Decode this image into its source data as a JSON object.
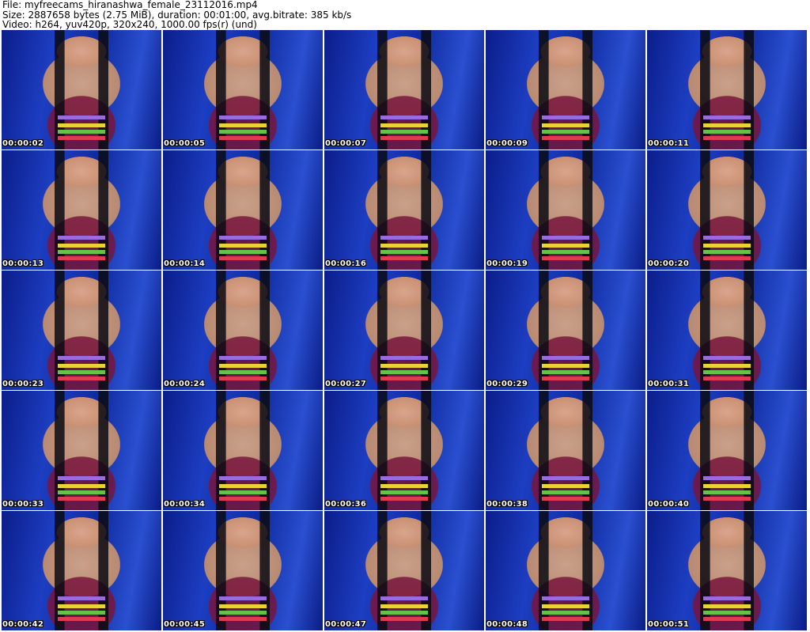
{
  "header": {
    "file_line": "File: myfreecams_hiranashwa_female_23112016.mp4",
    "size_line": "Size: 2887658 bytes (2.75 MiB), duration: 00:01:00, avg.bitrate: 385 kb/s",
    "video_line": "Video: h264, yuv420p, 320x240, 1000.00 fps(r) (und)"
  },
  "thumbnails": [
    "00:00:02",
    "00:00:05",
    "00:00:07",
    "00:00:09",
    "00:00:11",
    "00:00:13",
    "00:00:14",
    "00:00:16",
    "00:00:19",
    "00:00:20",
    "00:00:23",
    "00:00:24",
    "00:00:27",
    "00:00:29",
    "00:00:31",
    "00:00:33",
    "00:00:34",
    "00:00:36",
    "00:00:38",
    "00:00:40",
    "00:00:42",
    "00:00:45",
    "00:00:47",
    "00:00:48",
    "00:00:51"
  ]
}
